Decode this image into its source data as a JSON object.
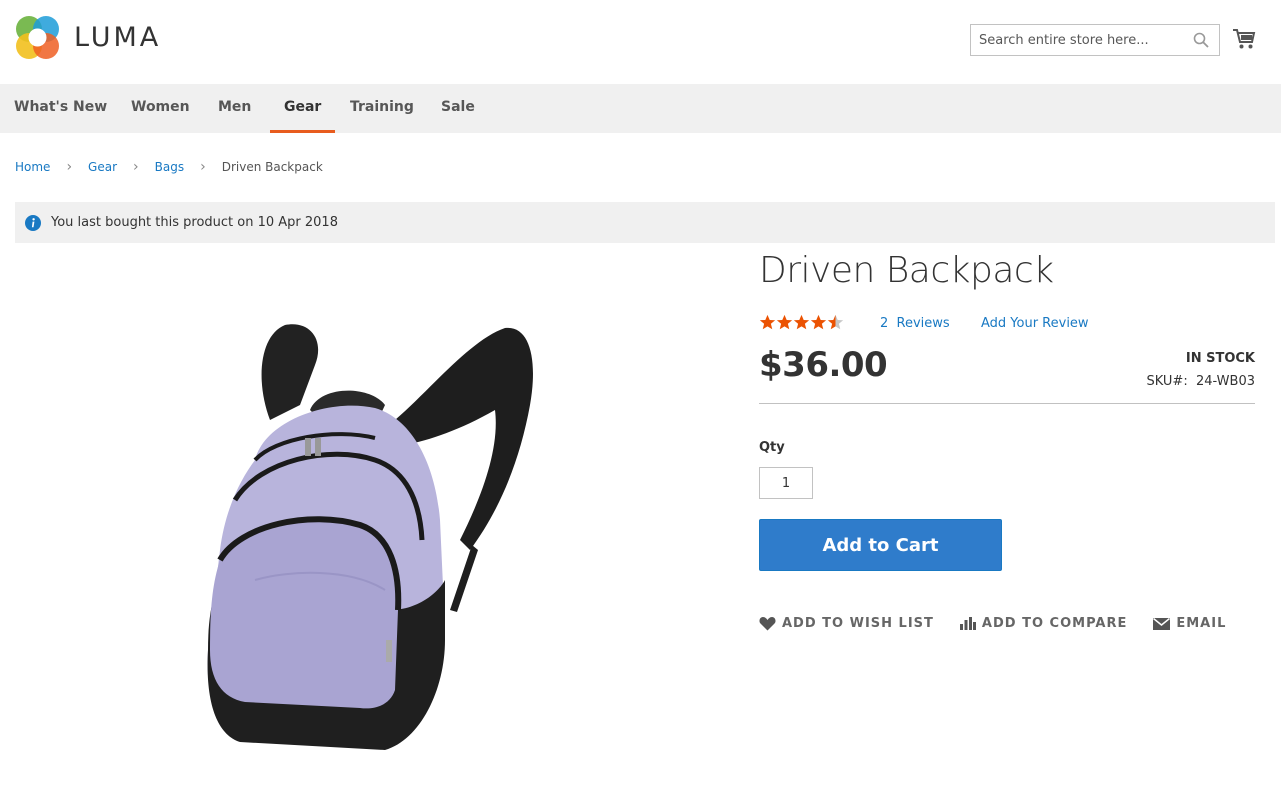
{
  "header": {
    "logo_text": "LUMA",
    "search_placeholder": "Search entire store here...",
    "cart_label": "cart-icon"
  },
  "nav": {
    "items": [
      {
        "label": "What's New",
        "active": false
      },
      {
        "label": "Women",
        "active": false
      },
      {
        "label": "Men",
        "active": false
      },
      {
        "label": "Gear",
        "active": true
      },
      {
        "label": "Training",
        "active": false
      },
      {
        "label": "Sale",
        "active": false
      }
    ]
  },
  "breadcrumb": {
    "items": [
      "Home",
      "Gear",
      "Bags"
    ],
    "current": "Driven Backpack"
  },
  "message": {
    "text": "You last bought this product on 10 Apr 2018"
  },
  "product": {
    "title": "Driven Backpack",
    "rating_fraction": 0.9,
    "reviews_count": "2",
    "reviews_label": "Reviews",
    "add_review_label": "Add Your Review",
    "price": "$36.00",
    "stock_status": "IN STOCK",
    "sku_label": "SKU#:",
    "sku_value": "24-WB03",
    "qty_label": "Qty",
    "qty_value": "1",
    "add_to_cart_label": "Add to Cart",
    "actions": {
      "wishlist": "ADD TO WISH LIST",
      "compare": "ADD TO COMPARE",
      "email": "EMAIL"
    }
  },
  "colors": {
    "accent": "#1979c3",
    "nav_active": "#e85c1e",
    "stars": "#eb5202"
  }
}
